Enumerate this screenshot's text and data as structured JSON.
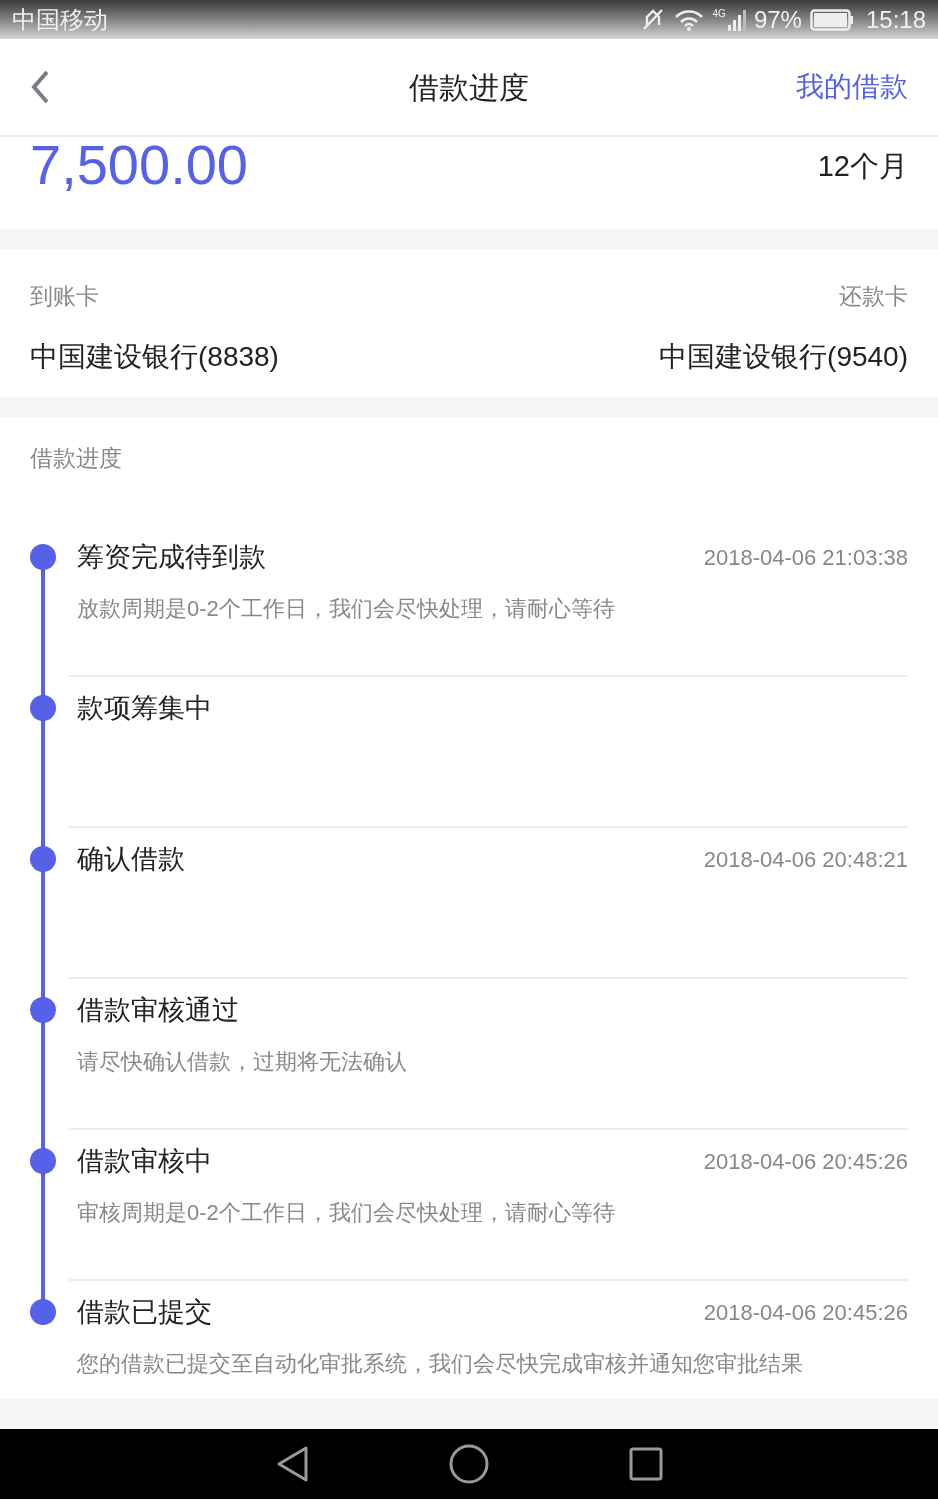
{
  "status_bar": {
    "carrier": "中国移动",
    "network": "4G",
    "battery": "97%",
    "time": "15:18"
  },
  "header": {
    "title": "借款进度",
    "action": "我的借款"
  },
  "loan": {
    "amount": "7,500.00",
    "term": "12个月"
  },
  "cards": [
    {
      "label": "到账卡",
      "bank": "中国建设银行(8838)"
    },
    {
      "label": "还款卡",
      "bank": "中国建设银行(9540)"
    }
  ],
  "progress": {
    "title": "借款进度",
    "steps": [
      {
        "title": "筹资完成待到款",
        "time": "2018-04-06 21:03:38",
        "description": "放款周期是0-2个工作日，我们会尽快处理，请耐心等待"
      },
      {
        "title": "款项筹集中"
      },
      {
        "title": "确认借款",
        "time": "2018-04-06 20:48:21"
      },
      {
        "title": "借款审核通过",
        "description": "请尽快确认借款，过期将无法确认"
      },
      {
        "title": "借款审核中",
        "time": "2018-04-06 20:45:26",
        "description": "审核周期是0-2个工作日，我们会尽快处理，请耐心等待"
      },
      {
        "title": "借款已提交",
        "time": "2018-04-06 20:45:26",
        "description": "您的借款已提交至自动化审批系统，我们会尽快完成审核并通知您审批结果"
      }
    ]
  }
}
